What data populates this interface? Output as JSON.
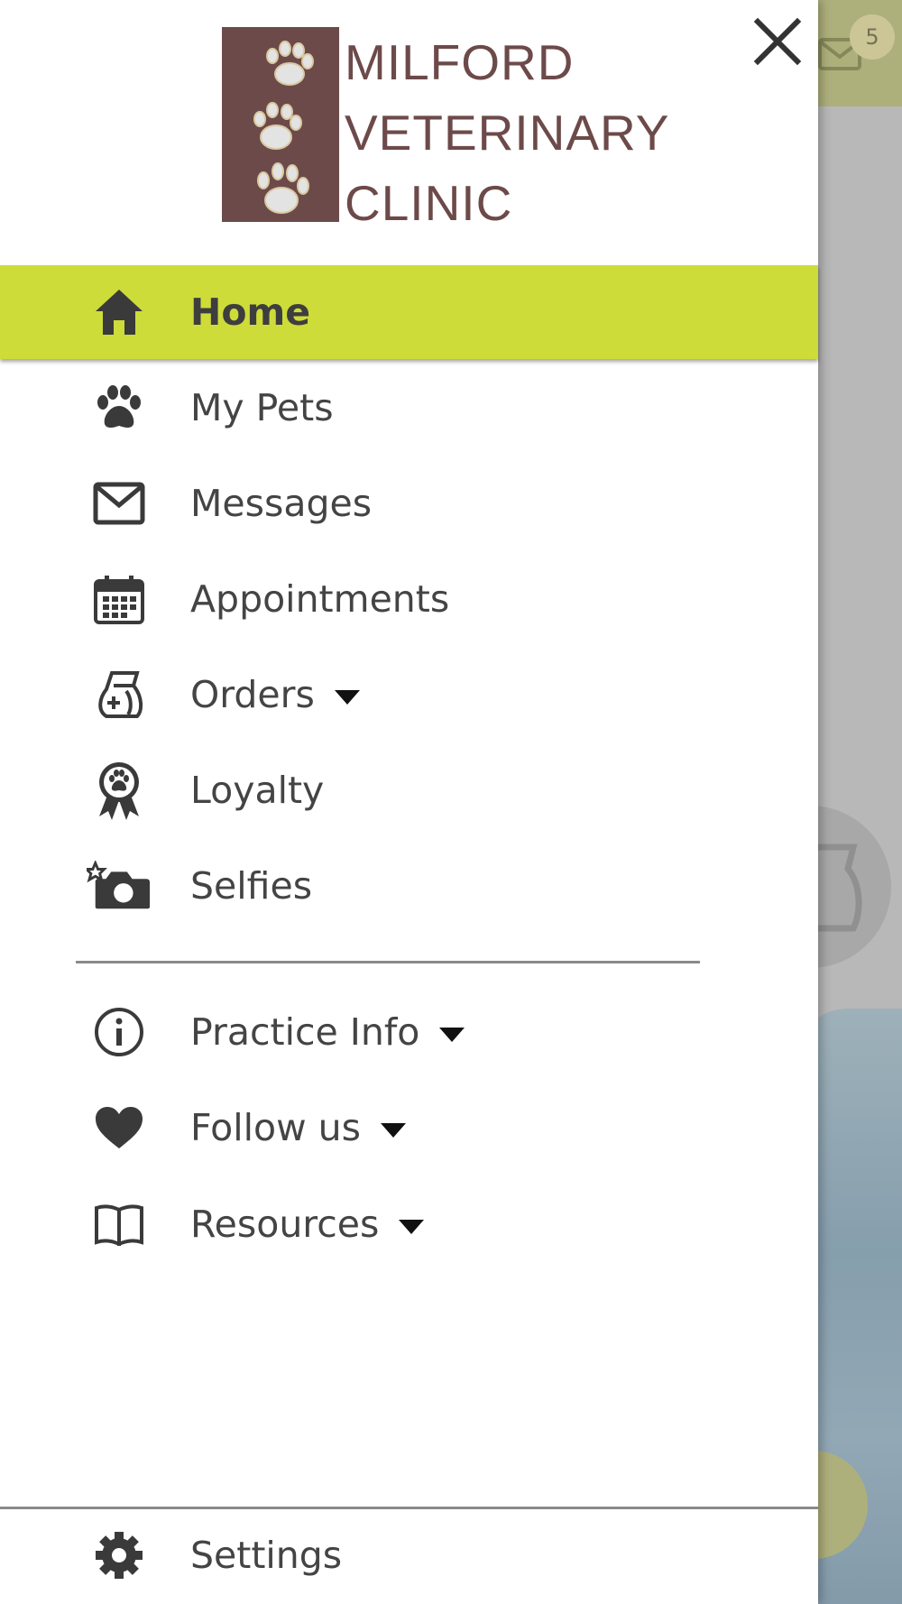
{
  "background": {
    "mail_badge_count": "5"
  },
  "drawer": {
    "logo": {
      "lines": [
        "MILFORD",
        "VETERINARY",
        "CLINIC"
      ],
      "brand_color": "#6d4a4a"
    },
    "accent_color": "#cddc39",
    "items": [
      {
        "label": "Home",
        "icon": "home-icon",
        "active": true
      },
      {
        "label": "My Pets",
        "icon": "paw-icon"
      },
      {
        "label": "Messages",
        "icon": "envelope-icon"
      },
      {
        "label": "Appointments",
        "icon": "calendar-icon"
      },
      {
        "label": "Orders",
        "icon": "food-bag-icon",
        "has_dropdown": true
      },
      {
        "label": "Loyalty",
        "icon": "award-ribbon-icon"
      },
      {
        "label": "Selfies",
        "icon": "camera-icon"
      },
      {
        "label": "Practice Info",
        "icon": "info-icon",
        "has_dropdown": true
      },
      {
        "label": "Follow us",
        "icon": "heart-icon",
        "has_dropdown": true
      },
      {
        "label": "Resources",
        "icon": "book-icon",
        "has_dropdown": true
      }
    ],
    "footer": {
      "label": "Settings",
      "icon": "gear-icon"
    }
  }
}
